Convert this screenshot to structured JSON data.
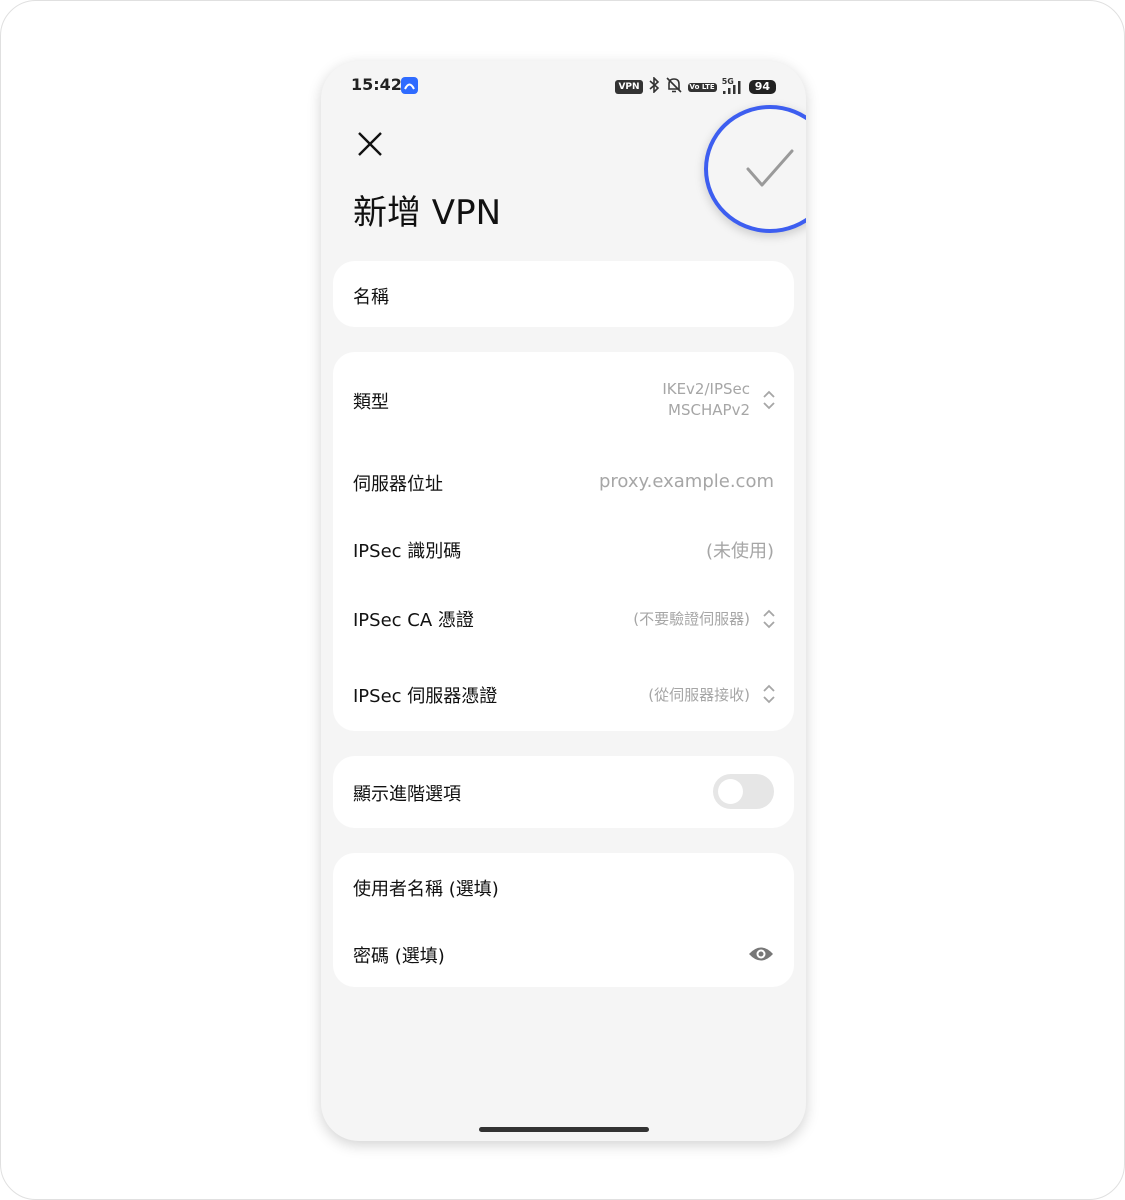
{
  "status_bar": {
    "time": "15:42",
    "vpn_badge": "VPN",
    "volte_badge": "Vo LTE",
    "network_label": "5G",
    "battery": "94"
  },
  "header": {
    "title": "新增 VPN"
  },
  "name_card": {
    "name_label": "名稱"
  },
  "config_card": {
    "type_label": "類型",
    "type_value_line1": "IKEv2/IPSec",
    "type_value_line2": "MSCHAPv2",
    "server_label": "伺服器位址",
    "server_placeholder": "proxy.example.com",
    "ipsec_id_label": "IPSec 識別碼",
    "ipsec_id_placeholder": "(未使用)",
    "ipsec_ca_label": "IPSec CA 憑證",
    "ipsec_ca_value": "(不要驗證伺服器)",
    "ipsec_server_cert_label": "IPSec 伺服器憑證",
    "ipsec_server_cert_value": "(從伺服器接收)"
  },
  "advanced_card": {
    "show_advanced_label": "顯示進階選項",
    "show_advanced_enabled": false
  },
  "credentials_card": {
    "username_label": "使用者名稱 (選填)",
    "password_label": "密碼 (選填)"
  },
  "colors": {
    "accent_ring": "#3d5ef0",
    "background": "#f5f5f5",
    "card": "#ffffff",
    "placeholder": "#a6a6a6"
  }
}
